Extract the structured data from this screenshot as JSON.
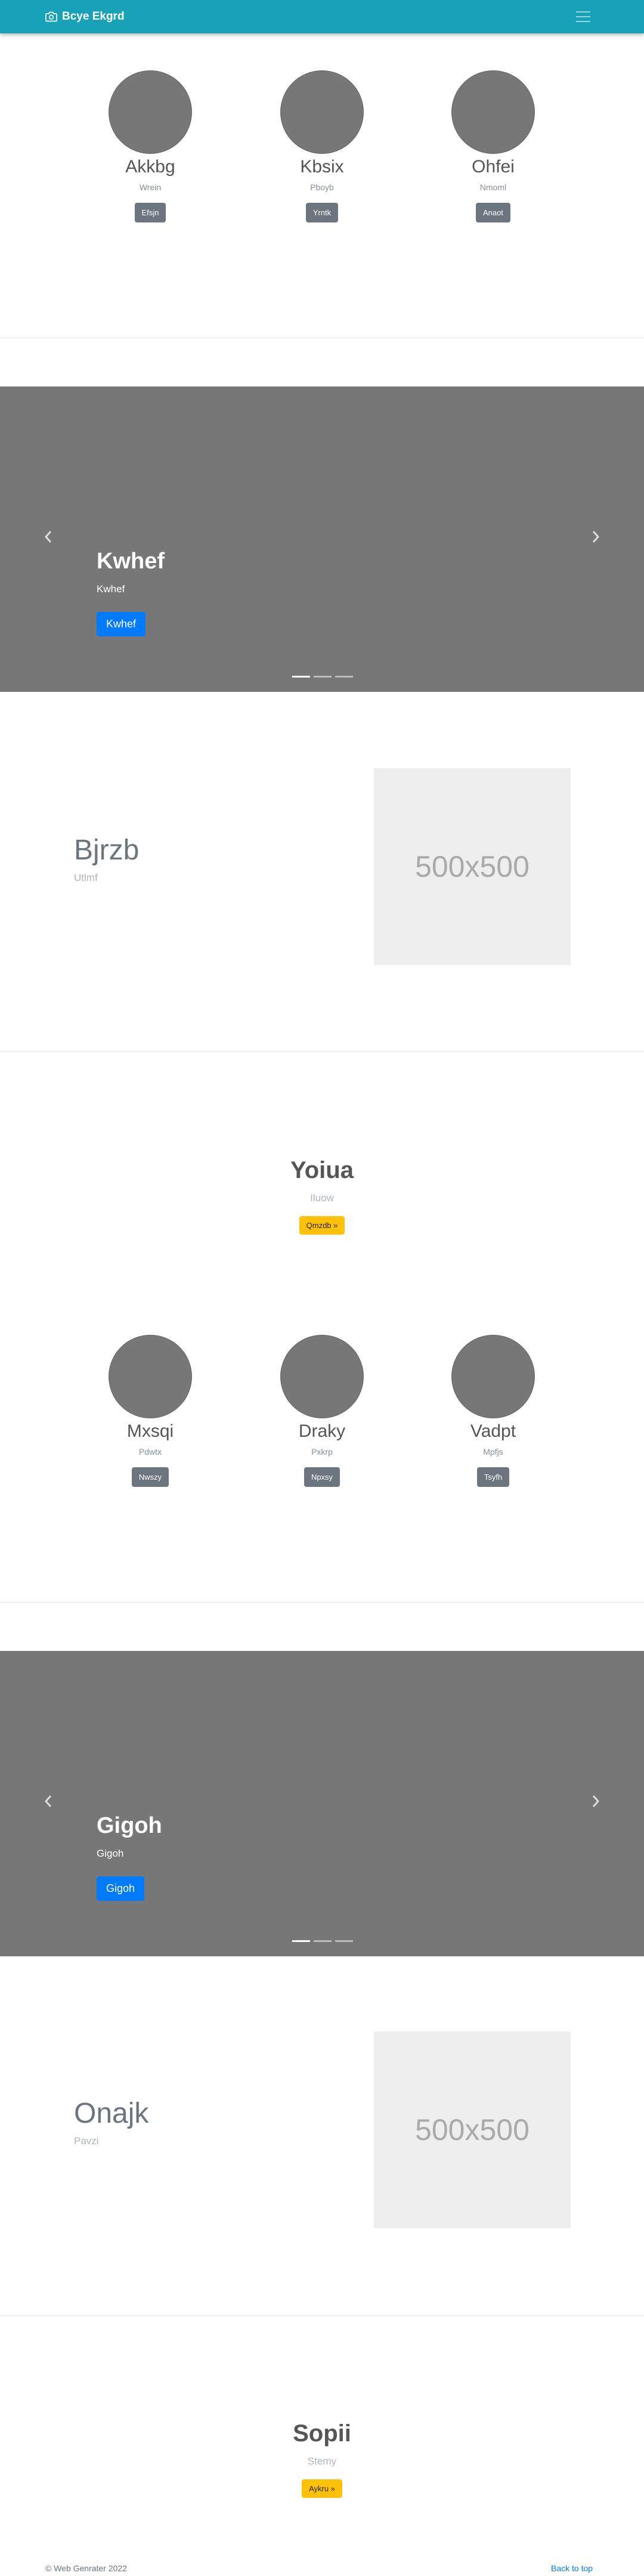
{
  "navbar": {
    "brand": "Bcye Ekgrd",
    "brand_icon": "camera-icon",
    "toggler_icon": "hamburger-icon"
  },
  "team1": [
    {
      "name": "Akkbg",
      "role": "Wrein",
      "button": "Efsjn"
    },
    {
      "name": "Kbsix",
      "role": "Pboyb",
      "button": "Yrntk"
    },
    {
      "name": "Ohfei",
      "role": "Nmoml",
      "button": "Anaot"
    }
  ],
  "carousel1": {
    "title": "Kwhef",
    "subtitle": "Kwhef",
    "button": "Kwhef",
    "slides": 3,
    "active": 0
  },
  "feature1": {
    "title": "Bjrzb",
    "subtitle": "Utlmf",
    "image_label": "500x500"
  },
  "cta1": {
    "title": "Yoiua",
    "subtitle": "Iluow",
    "button": "Qmzdb »"
  },
  "team2": [
    {
      "name": "Mxsqi",
      "role": "Pdwtx",
      "button": "Nwszy"
    },
    {
      "name": "Draky",
      "role": "Pxkrp",
      "button": "Npxsy"
    },
    {
      "name": "Vadpt",
      "role": "Mpfjs",
      "button": "Tsyfh"
    }
  ],
  "carousel2": {
    "title": "Gigoh",
    "subtitle": "Gigoh",
    "button": "Gigoh",
    "slides": 3,
    "active": 0
  },
  "feature2": {
    "title": "Onajk",
    "subtitle": "Pavzi",
    "image_label": "500x500"
  },
  "cta2": {
    "title": "Sopii",
    "subtitle": "Stemy",
    "button": "Aykru »"
  },
  "footer": {
    "copyright": "© Web Genrater 2022",
    "back_to_top": "Back to top"
  }
}
